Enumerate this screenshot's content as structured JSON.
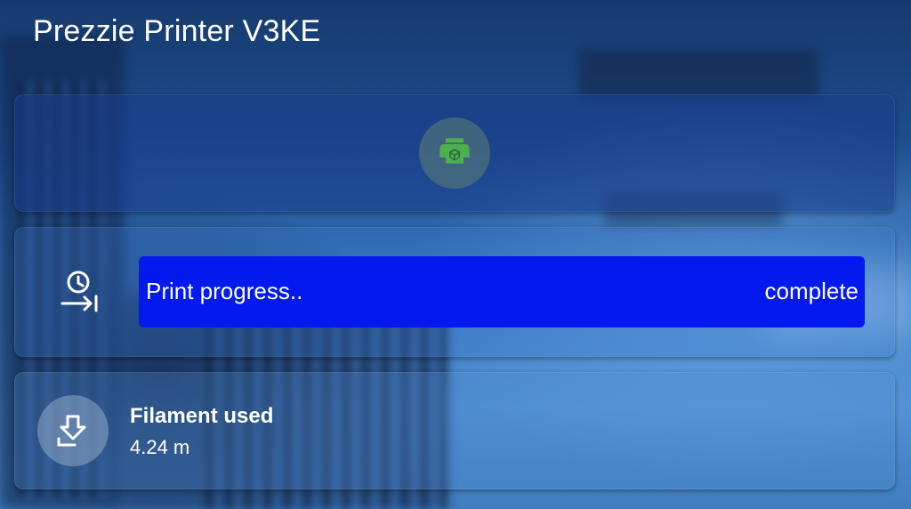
{
  "header": {
    "title": "Prezzie Printer V3KE"
  },
  "status_card": {
    "icon": "printer-3d-icon",
    "icon_color": "#4caf50"
  },
  "progress_card": {
    "icon": "clock-end-icon",
    "label": "Print progress..",
    "state": "complete",
    "progress": 1.0,
    "bar_color": "#0319ee"
  },
  "filament_card": {
    "icon": "tray-arrow-down-icon",
    "name": "Filament used",
    "value": "4.24 m"
  }
}
